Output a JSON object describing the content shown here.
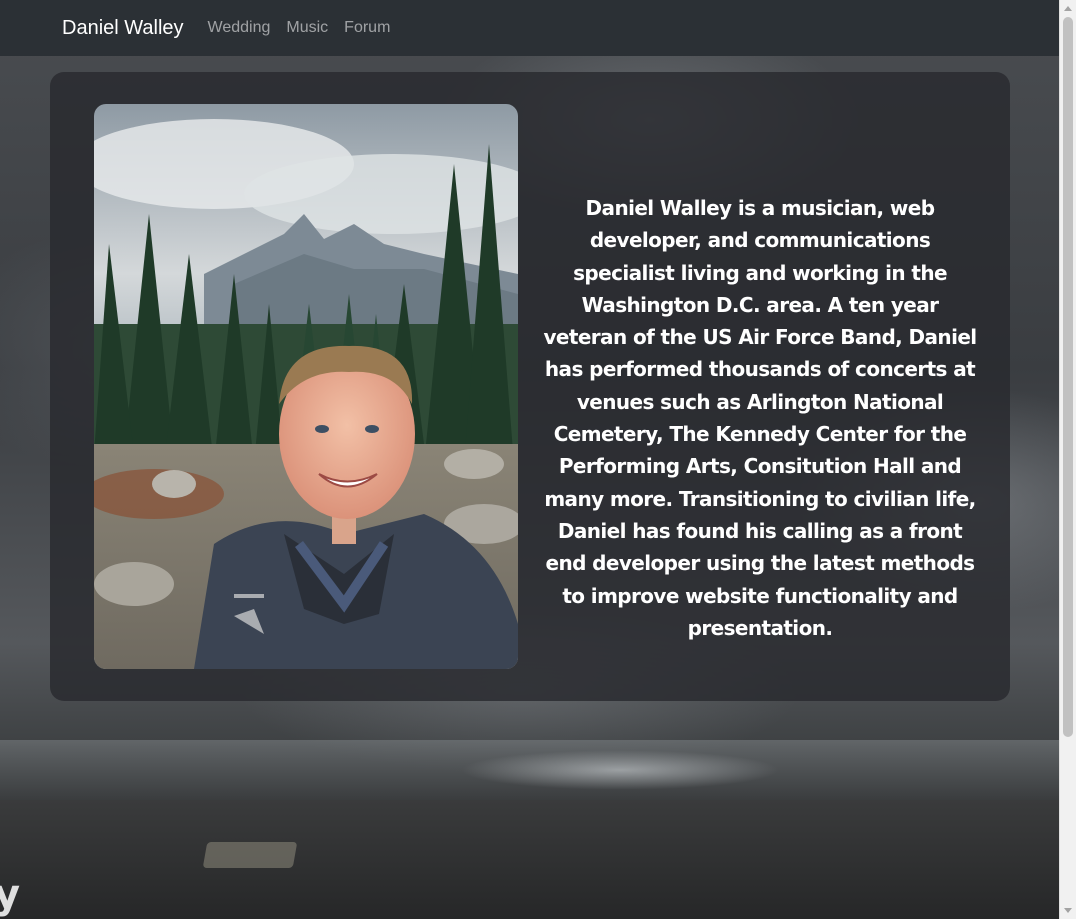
{
  "navbar": {
    "brand": "Daniel Walley",
    "links": [
      "Wedding",
      "Music",
      "Forum"
    ]
  },
  "about": {
    "photo_alt": "Daniel Walley selfie in front of mountains and pine trees",
    "bio": "Daniel Walley is a musician, web developer, and communications specialist living and working in the Washington D.C. area. A ten year veteran of the US Air Force Band, Daniel has performed thousands of concerts at venues such as Arlington National Cemetery, The Kennedy Center for the Performing Arts, Consitution Hall and many more. Transitioning to civilian life, Daniel has found his calling as a front end developer using the latest methods to improve website functionality and presentation."
  },
  "background": {
    "edge_text": "y"
  },
  "colors": {
    "navbar_bg": "#2b3035",
    "card_bg": "#282a2e",
    "text": "#ffffff"
  }
}
